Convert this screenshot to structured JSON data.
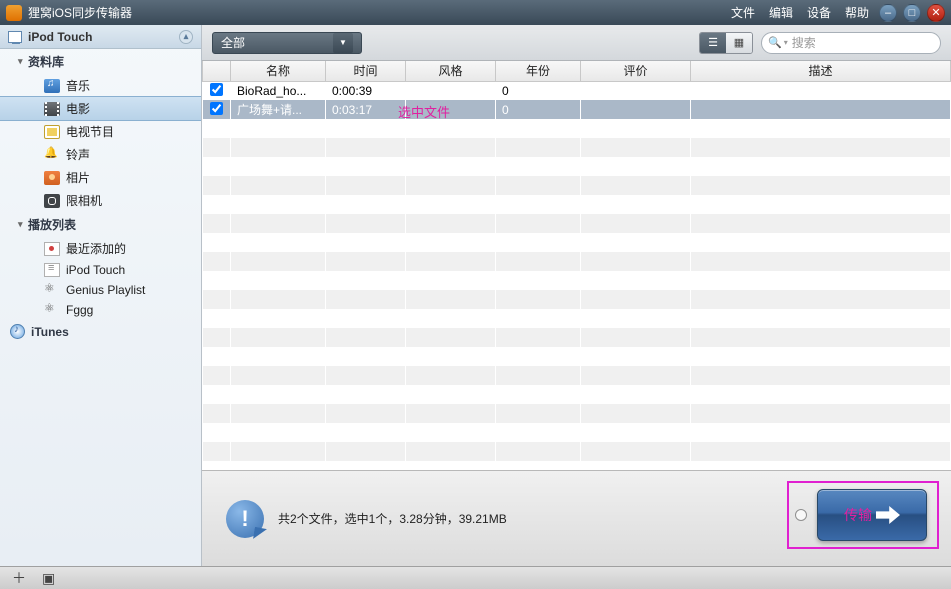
{
  "title": "狸窝iOS同步传输器",
  "menus": {
    "file": "文件",
    "edit": "编辑",
    "device": "设备",
    "help": "帮助"
  },
  "sidebar": {
    "device": "iPod Touch",
    "groups": [
      {
        "label": "资料库",
        "items": [
          {
            "label": "音乐",
            "icon": "music"
          },
          {
            "label": "电影",
            "icon": "movie",
            "selected": true
          },
          {
            "label": "电视节目",
            "icon": "tv"
          },
          {
            "label": "铃声",
            "icon": "bell"
          },
          {
            "label": "相片",
            "icon": "photo"
          },
          {
            "label": "限相机",
            "icon": "camera"
          }
        ]
      },
      {
        "label": "播放列表",
        "items": [
          {
            "label": "最近添加的",
            "icon": "pl"
          },
          {
            "label": "iPod Touch",
            "icon": "pl2"
          },
          {
            "label": "Genius Playlist",
            "icon": "genius"
          },
          {
            "label": "Fggg",
            "icon": "genius"
          }
        ]
      }
    ],
    "itunes": "iTunes"
  },
  "toolbar": {
    "filter": "全部",
    "search_placeholder": "搜索"
  },
  "columns": {
    "name": "名称",
    "time": "时间",
    "style": "风格",
    "year": "年份",
    "rating": "评价",
    "desc": "描述"
  },
  "rows": [
    {
      "checked": true,
      "name": "BioRad_ho...",
      "time": "0:00:39",
      "style": "",
      "year": "0",
      "rating": "",
      "desc": "",
      "selected": false
    },
    {
      "checked": true,
      "name": "广场舞+请...",
      "time": "0:03:17",
      "style": "",
      "year": "0",
      "rating": "",
      "desc": "",
      "selected": true
    }
  ],
  "annotation": "选中文件",
  "status": "共2个文件，选中1个，3.28分钟，39.21MB",
  "transfer_label": "传输"
}
